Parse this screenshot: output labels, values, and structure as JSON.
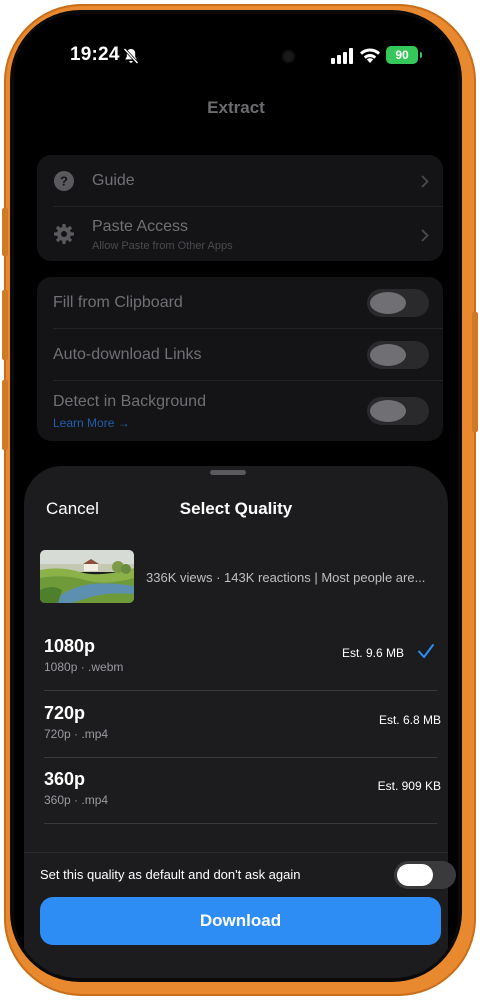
{
  "status_bar": {
    "time": "19:24",
    "battery": "90",
    "battery_color": "#35c759"
  },
  "nav": {
    "title": "Extract"
  },
  "settings": {
    "group1": [
      {
        "label": "Guide",
        "icon": "question-circle-icon"
      },
      {
        "label": "Paste Access",
        "subtitle": "Allow Paste from Other Apps",
        "icon": "gear-icon"
      }
    ],
    "group2": [
      {
        "label": "Fill from Clipboard",
        "enabled": false
      },
      {
        "label": "Auto-download Links",
        "enabled": false
      },
      {
        "label": "Detect in Background",
        "link": "Learn More →",
        "enabled": false
      }
    ]
  },
  "sheet": {
    "cancel": "Cancel",
    "title": "Select Quality",
    "video": {
      "description": "336K views · 143K reactions | Most people are..."
    },
    "qualities": [
      {
        "name": "1080p",
        "meta": "1080p · .webm",
        "size": "Est. 9.6 MB",
        "selected": true
      },
      {
        "name": "720p",
        "meta": "720p · .mp4",
        "size": "Est. 6.8 MB",
        "selected": false
      },
      {
        "name": "360p",
        "meta": "360p · .mp4",
        "size": "Est. 909 KB",
        "selected": false
      }
    ],
    "default_label": "Set this quality as default and don't ask again",
    "default_enabled": false,
    "download": "Download"
  },
  "colors": {
    "accent": "#2e8cf5",
    "frame": "#e8892f"
  }
}
